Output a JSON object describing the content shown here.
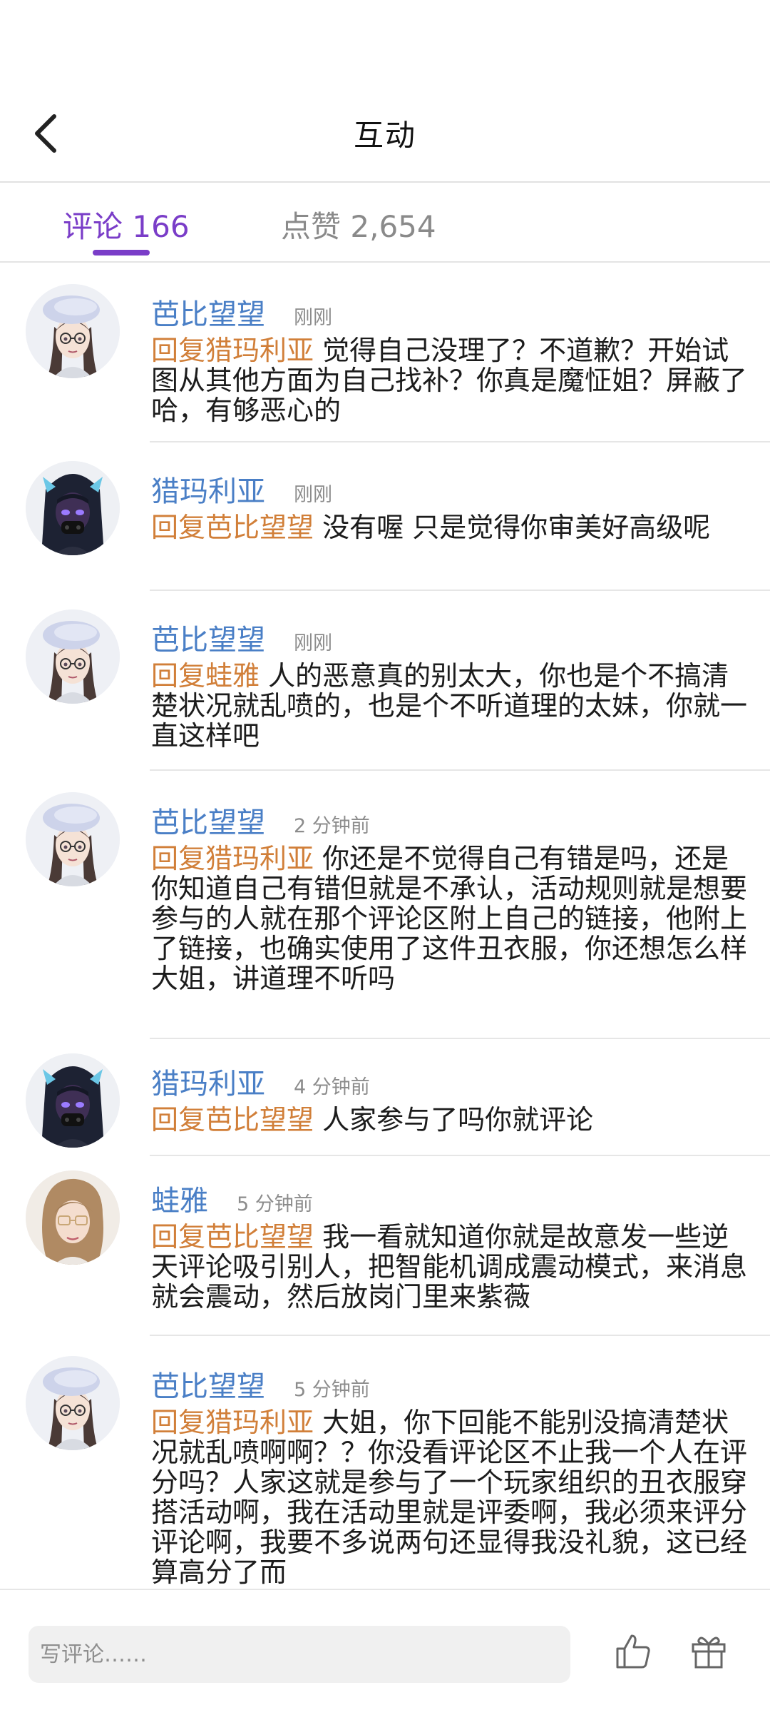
{
  "header": {
    "title": "互动"
  },
  "tabs": {
    "comments": {
      "label": "评论",
      "count": "166"
    },
    "likes": {
      "label": "点赞",
      "count": "2,654"
    }
  },
  "comments": [
    {
      "name": "芭比望望",
      "time": "刚刚",
      "reply_prefix": "回复猎玛利亚",
      "text": "觉得自己没理了？不道歉？开始试图从其他方面为自己找补？你真是魔怔姐？屏蔽了哈，有够恶心的",
      "avatar": "white-beret-girl"
    },
    {
      "name": "猎玛利亚",
      "time": "刚刚",
      "reply_prefix": "回复芭比望望",
      "text": "没有喔 只是觉得你审美好高级呢",
      "avatar": "dark-mask-girl"
    },
    {
      "name": "芭比望望",
      "time": "刚刚",
      "reply_prefix": "回复蛙雅",
      "text": "人的恶意真的别太大，你也是个不搞清楚状况就乱喷的，也是个不听道理的太妹，你就一直这样吧",
      "avatar": "white-beret-girl"
    },
    {
      "name": "芭比望望",
      "time": "2 分钟前",
      "reply_prefix": "回复猎玛利亚",
      "text": "你还是不觉得自己有错是吗，还是你知道自己有错但就是不承认，活动规则就是想要参与的人就在那个评论区附上自己的链接，他附上了链接，也确实使用了这件丑衣服，你还想怎么样大姐，讲道理不听吗",
      "avatar": "white-beret-girl"
    },
    {
      "name": "猎玛利亚",
      "time": "4 分钟前",
      "reply_prefix": "回复芭比望望",
      "text": "人家参与了吗你就评论",
      "avatar": "dark-mask-girl"
    },
    {
      "name": "蛙雅",
      "time": "5 分钟前",
      "reply_prefix": "回复芭比望望",
      "text": "我一看就知道你就是故意发一些逆天评论吸引别人，把智能机调成震动模式，来消息就会震动，然后放岗门里来紫薇",
      "avatar": "brown-hair-girl"
    },
    {
      "name": "芭比望望",
      "time": "5 分钟前",
      "reply_prefix": "回复猎玛利亚",
      "text": "大姐，你下回能不能别没搞清楚状况就乱喷啊啊？？你没看评论区不止我一个人在评分吗？人家这就是参与了一个玩家组织的丑衣服穿搭活动啊，我在活动里就是评委啊，我必须来评分评论啊，我要不多说两句还显得我没礼貌，这已经算高分了而",
      "avatar": "white-beret-girl"
    }
  ],
  "bottom": {
    "input_placeholder": "写评论……"
  },
  "icons": {
    "back": "chevron-left-icon",
    "like": "thumbs-up-icon",
    "gift": "gift-icon"
  },
  "colors": {
    "accent": "#7a3dc8",
    "username": "#4a7fc6",
    "reply_prefix": "#d17f39"
  }
}
